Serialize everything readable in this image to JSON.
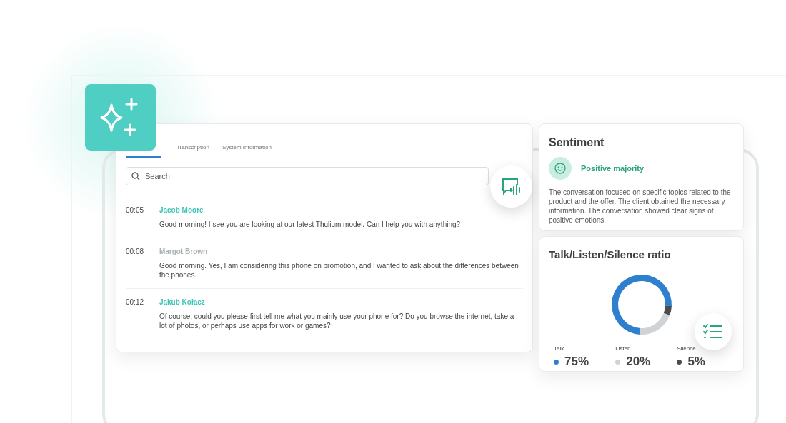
{
  "tabs": [
    {
      "label": "Transcription",
      "selected": false
    },
    {
      "label": "System Information",
      "selected": false
    }
  ],
  "search": {
    "placeholder": "Search"
  },
  "transcript": [
    {
      "time": "00:05",
      "speaker": "Jacob Moore",
      "color": "#3cc4b4",
      "text": "Good morning! I see you are looking at our latest Thulium model. Can I help you with anything?"
    },
    {
      "time": "00:08",
      "speaker": "Margot Brown",
      "color": "#a9b0b3",
      "text": "Good morning. Yes, I am considering this phone on promotion, and I wanted to ask about the differences between the phones."
    },
    {
      "time": "00:12",
      "speaker": "Jakub Kołacz",
      "color": "#3cc4b4",
      "text": "Of course, could you please first tell me what you mainly use your phone for? Do you browse the internet, take a lot of photos, or perhaps use apps for work or games?"
    }
  ],
  "sentiment": {
    "title": "Sentiment",
    "label": "Positive majority",
    "summary": "The conversation focused on specific topics related to the product and the offer. The client obtained the necessary information. The conversation showed clear signs of positive emotions."
  },
  "ratio": {
    "title": "Talk/Listen/Silence ratio",
    "legend": [
      {
        "value": "75%",
        "color": "#2f7fcf"
      },
      {
        "value": "20%",
        "color": "#cfd3d6"
      },
      {
        "value": "5%",
        "color": "#4a4d50"
      }
    ],
    "chart_data": {
      "type": "donut",
      "categories": [
        "Talk",
        "Listen",
        "Silence"
      ],
      "values": [
        75,
        20,
        5
      ]
    }
  }
}
